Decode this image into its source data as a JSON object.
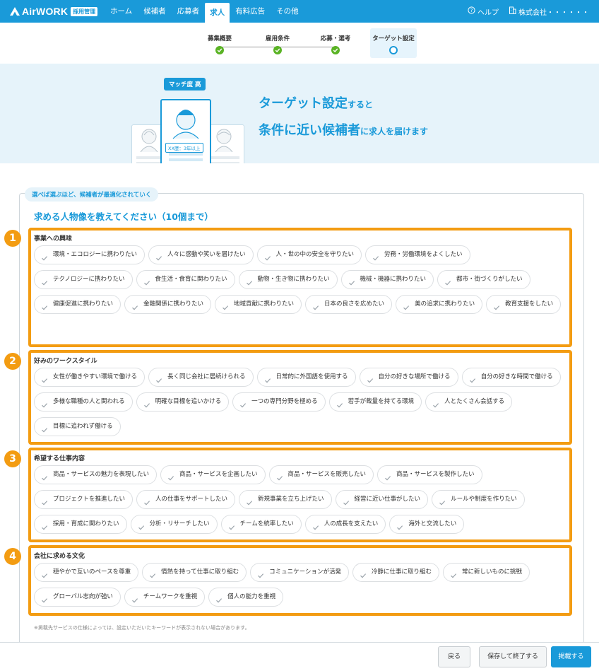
{
  "nav": {
    "logo": "AirWORK",
    "logo_badge": "採用管理",
    "items": [
      "ホーム",
      "候補者",
      "応募者",
      "求人",
      "有料広告",
      "その他"
    ],
    "active_index": 3,
    "help": "ヘルプ",
    "company": "株式会社・・・・・・"
  },
  "steps": [
    {
      "label": "募集概要",
      "status": "done"
    },
    {
      "label": "雇用条件",
      "status": "done"
    },
    {
      "label": "応募・選考",
      "status": "done"
    },
    {
      "label": "ターゲット設定",
      "status": "current"
    }
  ],
  "hero": {
    "match_badge": "マッチ度 高",
    "exp_tag": "XX歴：3年以上",
    "line1_big": "ターゲット設定",
    "line1_small": "すると",
    "line2_big": "条件に近い候補者",
    "line2_small1": "に",
    "line2_mid": "求人",
    "line2_small2": "を届けます"
  },
  "panel": {
    "tag": "選べば選ぶほど、候補者が最適化されていく",
    "title": "求める人物像を教えてください（10個まで）"
  },
  "sections": [
    {
      "num": "1",
      "title": "事業への興味",
      "chips": [
        "環境・エコロジーに携わりたい",
        "人々に感動や笑いを届けたい",
        "人・世の中の安全を守りたい",
        "労務・労働環境をよくしたい",
        "テクノロジーに携わりたい",
        "食生活・食育に関わりたい",
        "動物・生き物に携わりたい",
        "機械・機器に携わりたい",
        "都市・街づくりがしたい",
        "健康促進に携わりたい",
        "金融関係に携わりたい",
        "地域貢献に携わりたい",
        "日本の良さを広めたい",
        "美の追求に携わりたい",
        "教育支援をしたい"
      ]
    },
    {
      "num": "2",
      "title": "好みのワークスタイル",
      "chips": [
        "女性が働きやすい環境で働ける",
        "長く同じ会社に居続けられる",
        "日常的に外国語を使用する",
        "自分の好きな場所で働ける",
        "自分の好きな時間で働ける",
        "多様な職種の人と関われる",
        "明確な目標を追いかける",
        "一つの専門分野を極める",
        "若手が裁量を持てる環境",
        "人とたくさん会話する",
        "目標に追われず働ける"
      ]
    },
    {
      "num": "3",
      "title": "希望する仕事内容",
      "chips": [
        "商品・サービスの魅力を表現したい",
        "商品・サービスを企画したい",
        "商品・サービスを販売したい",
        "商品・サービスを製作したい",
        "プロジェクトを推進したい",
        "人の仕事をサポートしたい",
        "新規事業を立ち上げたい",
        "経営に近い仕事がしたい",
        "ルールや制度を作りたい",
        "採用・育成に関わりたい",
        "分析・リサーチしたい",
        "チームを統率したい",
        "人の成長を支えたい",
        "海外と交流したい"
      ]
    },
    {
      "num": "4",
      "title": "会社に求める文化",
      "chips": [
        "穏やかで互いのペースを尊重",
        "情熱を持って仕事に取り組む",
        "コミュニケーションが活発",
        "冷静に仕事に取り組む",
        "常に新しいものに挑戦",
        "グローバル志向が強い",
        "チームワークを重視",
        "個人の能力を重視"
      ]
    }
  ],
  "footnote": "※掲載先サービスの仕様によっては、設定いただいたキーワードが表示されない場合があります。",
  "footer": {
    "back": "戻る",
    "save_exit": "保存して終了する",
    "publish": "掲載する"
  },
  "colors": {
    "primary": "#1a9ad9",
    "highlight": "#f39c12",
    "done": "#5ab324"
  }
}
